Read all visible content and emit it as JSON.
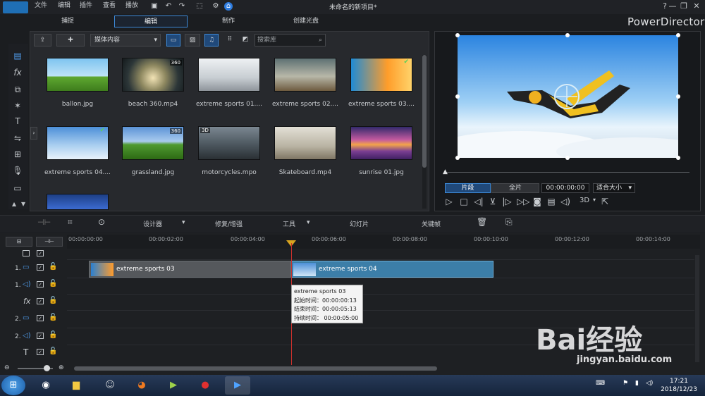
{
  "menu": {
    "file": "文件",
    "edit": "编辑",
    "plugins": "插件",
    "view": "查看",
    "play": "播放"
  },
  "window_title": "未命名的新项目*",
  "win_controls": {
    "help": "?",
    "minimize": "—",
    "restore": "❐",
    "close": "✕"
  },
  "tabs": [
    "捕捉",
    "编辑",
    "制作",
    "创建光盘"
  ],
  "brand": "PowerDirector",
  "library": {
    "dropdown": "媒体内容",
    "search_placeholder": "搜索库",
    "items": [
      {
        "label": "ballon.jpg",
        "badge": ""
      },
      {
        "label": "beach 360.mp4",
        "badge": "360"
      },
      {
        "label": "extreme sports 01....",
        "badge": ""
      },
      {
        "label": "extreme sports 02....",
        "badge": ""
      },
      {
        "label": "extreme sports 03....",
        "badge": "✔"
      },
      {
        "label": "extreme sports 04....",
        "badge": "✔"
      },
      {
        "label": "grassland.jpg",
        "badge": "360"
      },
      {
        "label": "motorcycles.mpo",
        "badge": "3D"
      },
      {
        "label": "Skateboard.mp4",
        "badge": ""
      },
      {
        "label": "sunrise 01.jpg",
        "badge": ""
      }
    ]
  },
  "preview": {
    "clip_btn": "片段",
    "full_btn": "全片",
    "timecode": "00:00:00:00",
    "fit": "适合大小",
    "mode3d": "3D"
  },
  "toolbar": {
    "designer": "设计器",
    "fix": "修复/增强",
    "tools": "工具",
    "slideshow": "幻灯片",
    "keyframe": "关键帧"
  },
  "ruler": [
    "00:00:00:00",
    "00:00:02:00",
    "00:00:04:00",
    "00:00:06:00",
    "00:00:08:00",
    "00:00:10:00",
    "00:00:12:00",
    "00:00:14:00"
  ],
  "tracks": [
    "1.",
    "1.",
    "",
    "2.",
    "2.",
    ""
  ],
  "clips": {
    "a": "extreme sports 03",
    "b": "extreme sports 04"
  },
  "tooltip": {
    "name": "extreme sports 03",
    "start": "起始时间：00:00:00:13",
    "end": "结束时间：00:00:05:13",
    "dur": "持续时间：  00:00:05:00"
  },
  "clock": {
    "time": "17:21",
    "date": "2018/12/23"
  },
  "watermark": {
    "big": "Bai经验",
    "small": "jingyan.baidu.com"
  }
}
